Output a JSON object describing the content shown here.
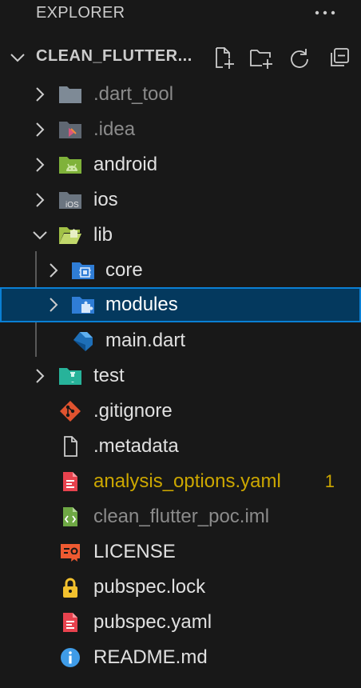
{
  "explorer": {
    "title": "EXPLORER",
    "more_label": "···"
  },
  "section": {
    "title": "CLEAN_FLUTTER..."
  },
  "tree": {
    "dart_tool": ".dart_tool",
    "idea": ".idea",
    "android": "android",
    "ios": "ios",
    "lib": "lib",
    "core": "core",
    "modules": "modules",
    "main_dart": "main.dart",
    "test": "test",
    "gitignore": ".gitignore",
    "metadata": ".metadata",
    "analysis_options": "analysis_options.yaml",
    "analysis_options_badge": "1",
    "iml": "clean_flutter_poc.iml",
    "license": "LICENSE",
    "pubspec_lock": "pubspec.lock",
    "pubspec_yaml": "pubspec.yaml",
    "readme": "README.md"
  },
  "colors": {
    "background": "#181818",
    "selection": "#04395e",
    "selection_border": "#0a7fd4",
    "warning": "#cca700",
    "dim_text": "#8b8b8b"
  }
}
